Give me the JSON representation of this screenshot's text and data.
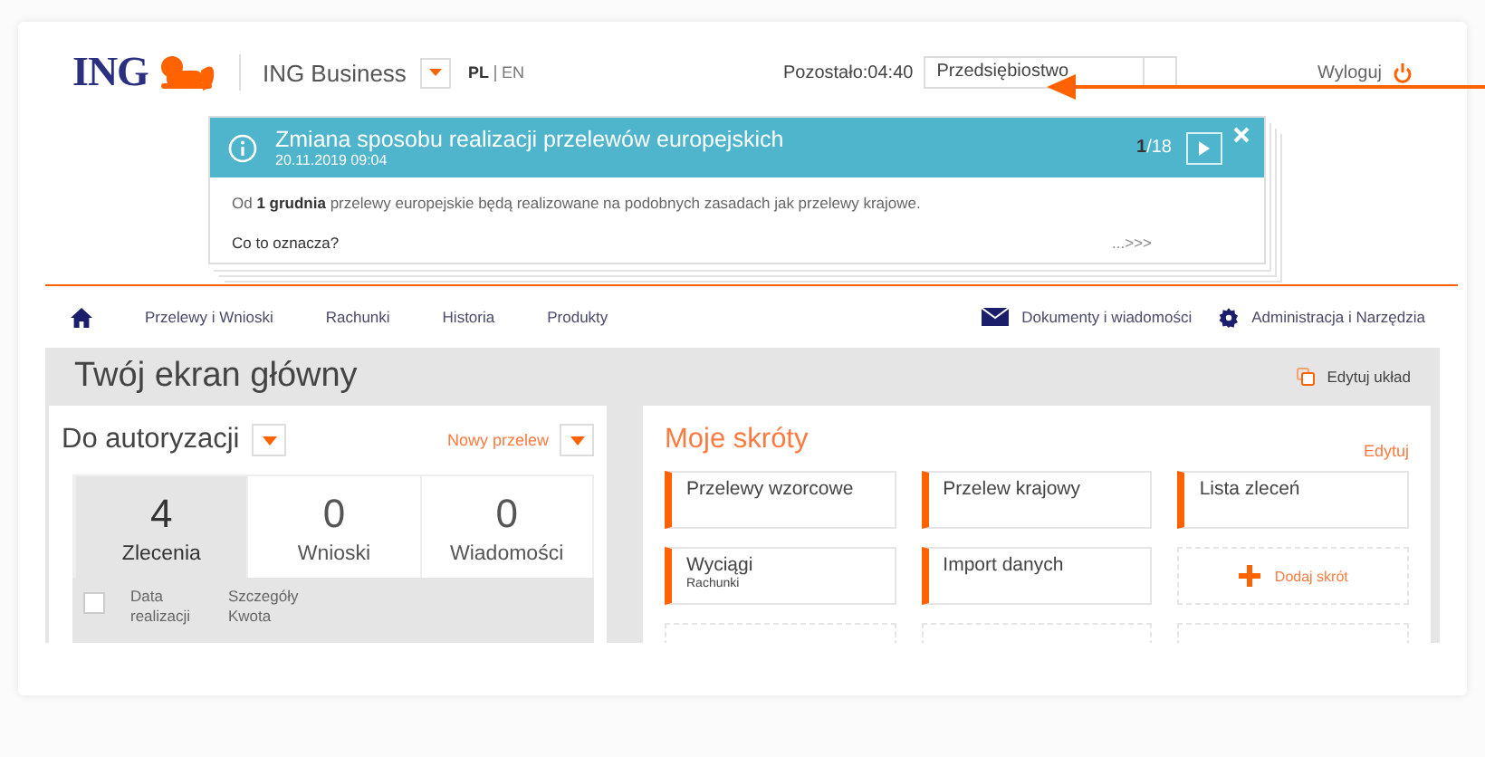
{
  "header": {
    "brand": "ING",
    "product": "ING Business",
    "languages": [
      {
        "label": "PL",
        "selected": true
      },
      {
        "label": "EN",
        "selected": false
      }
    ],
    "session_timer": "Pozostało:04:40",
    "company_select": {
      "value": "Przedsiębiostwo"
    },
    "logout": "Wyloguj"
  },
  "notification": {
    "title": "Zmiana sposobu realizacji przelewów europejskich",
    "date": "20.11.2019 09:04",
    "counter": "**1**/18",
    "body": "Od **1 grudnia** przelewy europejskie będą realizowane na podobnych zasadach jak przelewy krajowe.",
    "link": "Co to oznacza?",
    "more": "...>>>"
  },
  "nav": {
    "items": [
      "Przelewy i Wnioski",
      "Rachunki",
      "Historia",
      "Produkty"
    ],
    "right_items": [
      {
        "kind": "mail",
        "label": "Dokumenty i wiadomości"
      },
      {
        "kind": "gear",
        "label": "Administracja i Narzędzia"
      }
    ]
  },
  "dashboard": {
    "title": "Twój ekran główny",
    "edit_layout": "Edytuj układ"
  },
  "authorization": {
    "title": "Do autoryzacji",
    "new_transfer": "Nowy przelew",
    "tabs": [
      {
        "count": "4",
        "label": "Zlecenia",
        "selected": true
      },
      {
        "count": "0",
        "label": "Wnioski",
        "selected": false
      },
      {
        "count": "0",
        "label": "Wiadomości",
        "selected": false
      }
    ],
    "select_all": {
      "checked": false
    },
    "columns": [
      "Data realizacji",
      "Szczegóły Kwota"
    ]
  },
  "shortcuts": {
    "title": "Moje skróty",
    "edit": "Edytuj",
    "tiles": [
      {
        "kind": "shortcut",
        "label": "Przelewy wzorcowe"
      },
      {
        "kind": "shortcut",
        "label": "Przelew krajowy"
      },
      {
        "kind": "shortcut",
        "label": "Lista zleceń"
      },
      {
        "kind": "shortcut",
        "label": "Wyciągi",
        "sublabel": "Rachunki"
      },
      {
        "kind": "shortcut",
        "label": "Import danych"
      },
      {
        "kind": "add",
        "label": "Dodaj skrót"
      },
      {
        "kind": "empty"
      },
      {
        "kind": "empty"
      },
      {
        "kind": "empty"
      }
    ]
  },
  "annotation": {
    "kind": "arrow"
  }
}
